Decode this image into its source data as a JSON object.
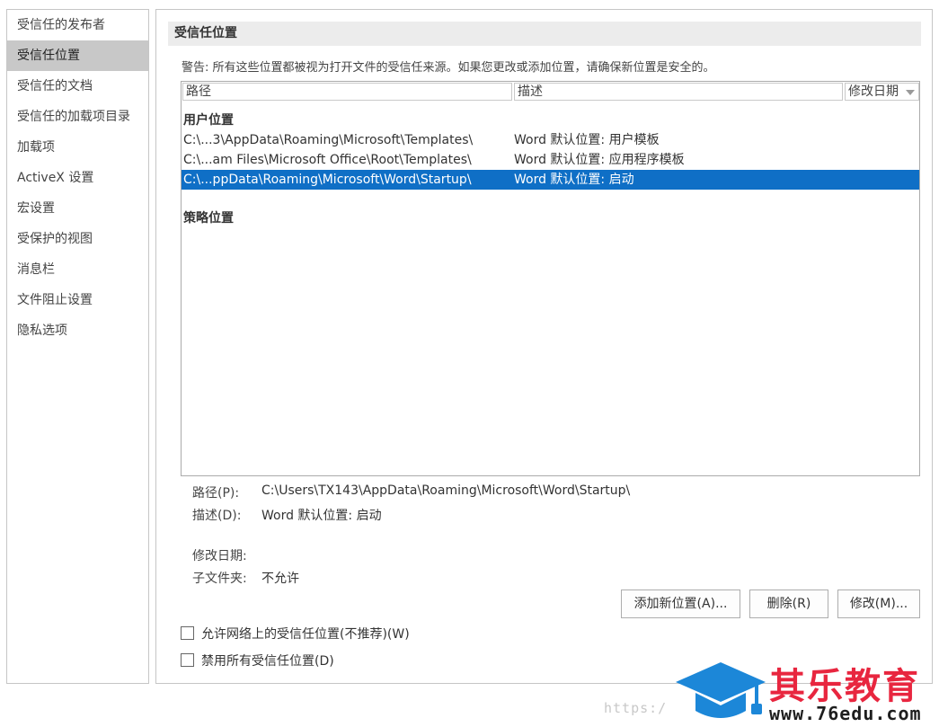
{
  "nav": {
    "items": [
      {
        "label": "受信任的发布者"
      },
      {
        "label": "受信任位置"
      },
      {
        "label": "受信任的文档"
      },
      {
        "label": "受信任的加载项目录"
      },
      {
        "label": "加载项"
      },
      {
        "label": "ActiveX 设置"
      },
      {
        "label": "宏设置"
      },
      {
        "label": "受保护的视图"
      },
      {
        "label": "消息栏"
      },
      {
        "label": "文件阻止设置"
      },
      {
        "label": "隐私选项"
      }
    ],
    "active_index": 1
  },
  "main": {
    "section_title": "受信任位置",
    "warning": "警告: 所有这些位置都被视为打开文件的受信任来源。如果您更改或添加位置，请确保新位置是安全的。",
    "columns": {
      "path": "路径",
      "description": "描述",
      "date": "修改日期"
    },
    "user_group": {
      "label": "用户位置",
      "rows": [
        {
          "path": "C:\\...3\\AppData\\Roaming\\Microsoft\\Templates\\",
          "description": "Word 默认位置: 用户模板",
          "selected": false
        },
        {
          "path": "C:\\...am Files\\Microsoft Office\\Root\\Templates\\",
          "description": "Word 默认位置: 应用程序模板",
          "selected": false
        },
        {
          "path": "C:\\...ppData\\Roaming\\Microsoft\\Word\\Startup\\",
          "description": "Word 默认位置: 启动",
          "selected": true
        }
      ]
    },
    "policy_group": {
      "label": "策略位置"
    },
    "details": {
      "path_label": "路径(P):",
      "path_value": "C:\\Users\\TX143\\AppData\\Roaming\\Microsoft\\Word\\Startup\\",
      "desc_label": "描述(D):",
      "desc_value": "Word 默认位置: 启动",
      "date_label": "修改日期:",
      "subfolder_label": "子文件夹:",
      "subfolder_value": "不允许"
    },
    "buttons": {
      "add": "添加新位置(A)...",
      "remove": "删除(R)",
      "modify": "修改(M)..."
    },
    "checkboxes": {
      "allow_network": {
        "label": "允许网络上的受信任位置(不推荐)(W)",
        "checked": false
      },
      "disable_all": {
        "label": "禁用所有受信任位置(D)",
        "checked": false
      }
    }
  },
  "watermark": {
    "url_text": "https:/",
    "brand": "其乐教育",
    "site": "www.76edu.com"
  },
  "colors": {
    "selection": "#0f6fc6",
    "brand_red": "#e8263f",
    "brand_blue": "#1c87d8"
  }
}
